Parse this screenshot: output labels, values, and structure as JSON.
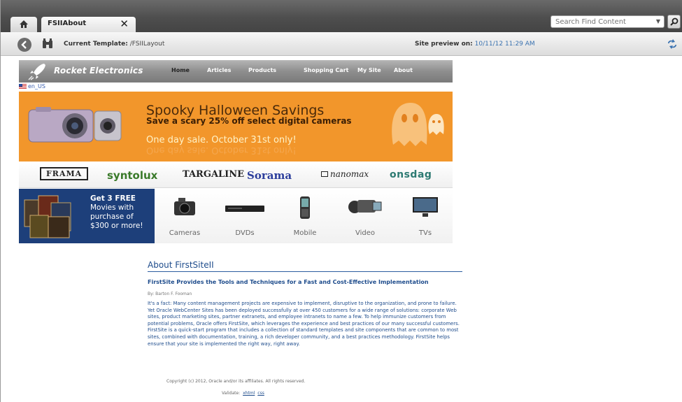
{
  "tabs": {
    "active_tab": "FSIIAbout",
    "close_glyph": "✕"
  },
  "search": {
    "placeholder": "Search Find Content"
  },
  "toolbar": {
    "template_label": "Current Template:",
    "template_value": "/FSIILayout",
    "preview_label": "Site preview on:",
    "preview_value": "10/11/12 11:29 AM"
  },
  "site": {
    "logo": "Rocket Electronics",
    "nav": [
      "Home",
      "Articles",
      "Products",
      "Shopping Cart",
      "My Site",
      "About"
    ],
    "locale": "en_US",
    "hero": {
      "headline": "Spooky Halloween Savings",
      "subline": "Save a scary 25% off select digital cameras",
      "tagline": "One day sale. October 31st only!"
    },
    "brands": [
      "FRAMA",
      "syntolux",
      "TARGALINE",
      "Sorama",
      "nanomax",
      "onsdag"
    ],
    "promo": [
      "Get 3 FREE",
      "Movies with",
      "purchase of",
      "$300 or more!"
    ],
    "products": [
      "Cameras",
      "DVDs",
      "Mobile",
      "Video",
      "TVs"
    ]
  },
  "article": {
    "title": "About FirstSiteII",
    "subtitle": "FirstSite Provides the Tools and Techniques for a Fast and Cost-Effective Implementation",
    "byline": "By: Barton F. Fooman",
    "body": "It's a fact: Many content management projects are expensive to implement, disruptive to the organization, and prone to failure. Yet Oracle WebCenter Sites has been deployed successfully at over 450 customers for a wide range of solutions: corporate Web sites, product marketing sites, partner extranets, and employee intranets to name a few. To help immunize customers from potential problems, Oracle offers FirstSite, which leverages the experience and best practices of our many successful customers. FirstSite is a quick-start program that includes a collection of standard templates and site components that are common to most sites, combined with documentation, training, a rich developer community, and a best practices methodology. FirstSite helps ensure that your site is implemented the right way, right away.",
    "copyright": "Copyright (c) 2012, Oracle and/or its affiliates. All rights reserved.",
    "validate_label": "Validate:",
    "validate_links": [
      "xhtml",
      "css"
    ]
  },
  "colors": {
    "accent": "#1e4c8c",
    "hero_bg": "#f2962b",
    "promo_bg": "#1d3f7a"
  }
}
